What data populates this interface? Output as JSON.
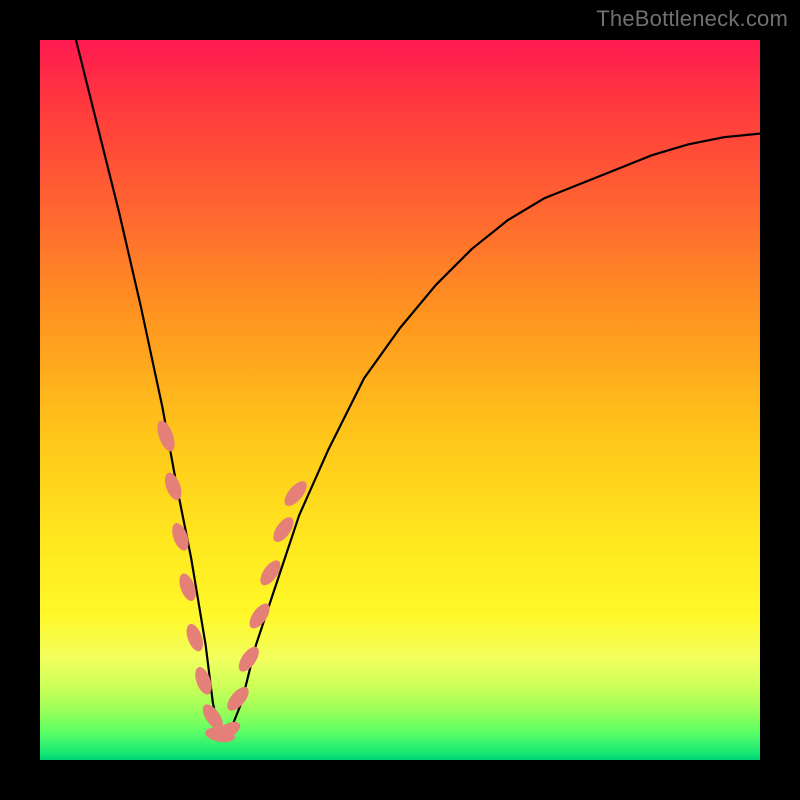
{
  "watermark": "TheBottleneck.com",
  "colors": {
    "background": "#000000",
    "gradient_top": "#ff1a51",
    "gradient_mid": "#ffe81f",
    "gradient_bottom": "#00d37a",
    "curve": "#000000",
    "bead": "#e58079"
  },
  "chart_data": {
    "type": "line",
    "title": "",
    "xlabel": "",
    "ylabel": "",
    "xlim": [
      0,
      100
    ],
    "ylim": [
      0,
      100
    ],
    "grid": false,
    "note": "No axis ticks or labels are visible; x and y are interpreted as 0–100 percent of the plot area. Higher y = higher on the chart (toward the red/top). Curve depicts a V-shaped bottleneck profile with minimum near x≈25.",
    "series": [
      {
        "name": "bottleneck-curve",
        "x": [
          5,
          8,
          11,
          14,
          17,
          19,
          21,
          23,
          24,
          25,
          26,
          28,
          30,
          33,
          36,
          40,
          45,
          50,
          55,
          60,
          65,
          70,
          75,
          80,
          85,
          90,
          95,
          100
        ],
        "y": [
          100,
          88,
          76,
          63,
          49,
          38,
          28,
          16,
          8,
          3,
          3,
          8,
          16,
          25,
          34,
          43,
          53,
          60,
          66,
          71,
          75,
          78,
          80,
          82,
          84,
          85.5,
          86.5,
          87
        ]
      }
    ],
    "annotations": {
      "beads": {
        "description": "Muted-pink elongated bead markers overlaid on the curve near the trough region.",
        "points": [
          {
            "x": 17.5,
            "y": 45,
            "len": 4.5,
            "angle": 70
          },
          {
            "x": 18.5,
            "y": 38,
            "len": 4.0,
            "angle": 70
          },
          {
            "x": 19.5,
            "y": 31,
            "len": 4.0,
            "angle": 70
          },
          {
            "x": 20.5,
            "y": 24,
            "len": 4.0,
            "angle": 70
          },
          {
            "x": 21.5,
            "y": 17,
            "len": 4.0,
            "angle": 70
          },
          {
            "x": 22.7,
            "y": 11,
            "len": 4.0,
            "angle": 70
          },
          {
            "x": 24.0,
            "y": 6,
            "len": 4.0,
            "angle": 55
          },
          {
            "x": 25.0,
            "y": 3.5,
            "len": 4.2,
            "angle": 10
          },
          {
            "x": 26.0,
            "y": 4.0,
            "len": 4.0,
            "angle": -30
          },
          {
            "x": 27.5,
            "y": 8.5,
            "len": 4.0,
            "angle": -50
          },
          {
            "x": 29.0,
            "y": 14,
            "len": 4.0,
            "angle": -55
          },
          {
            "x": 30.5,
            "y": 20,
            "len": 4.0,
            "angle": -55
          },
          {
            "x": 32.0,
            "y": 26,
            "len": 4.0,
            "angle": -55
          },
          {
            "x": 33.8,
            "y": 32,
            "len": 4.0,
            "angle": -55
          },
          {
            "x": 35.5,
            "y": 37,
            "len": 4.2,
            "angle": -50
          }
        ]
      }
    }
  }
}
